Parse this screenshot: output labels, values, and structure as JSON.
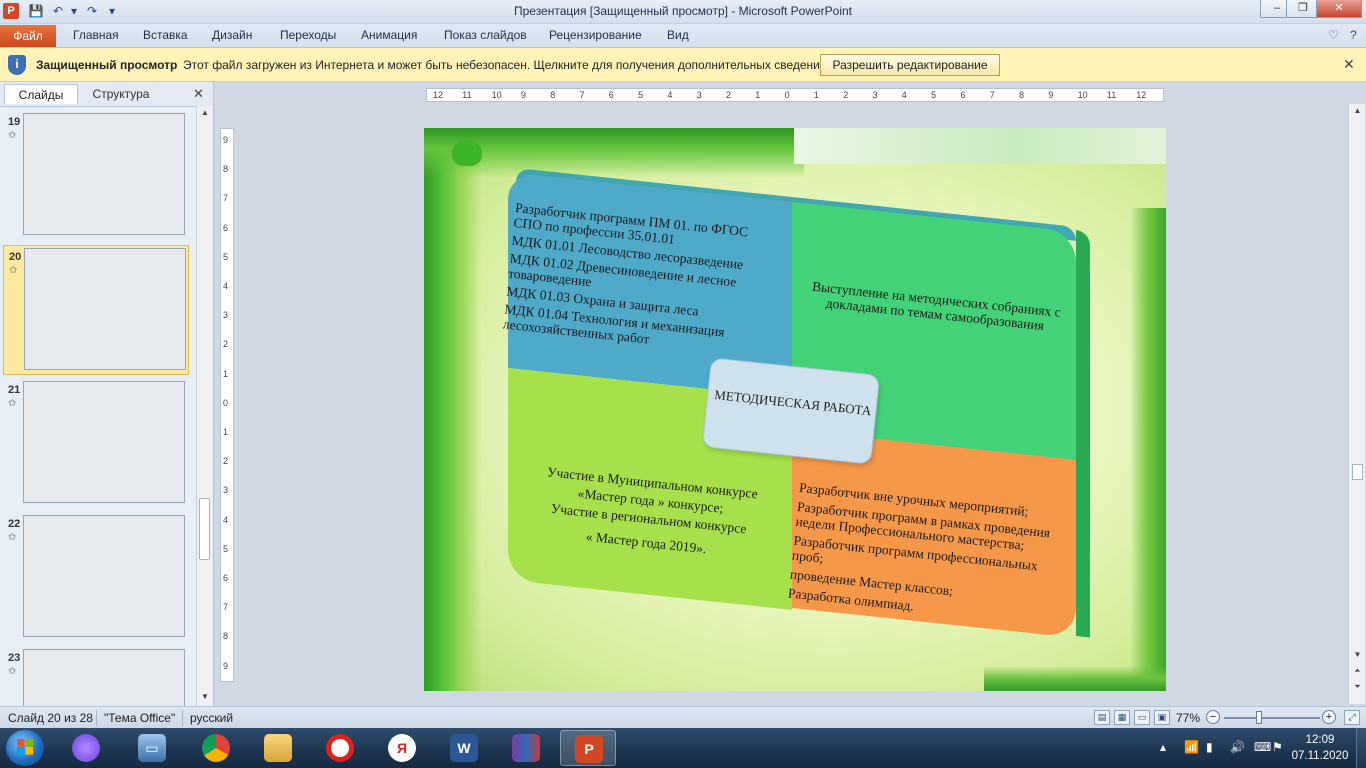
{
  "window": {
    "title": "Презентация [Защищенный просмотр]  -  Microsoft PowerPoint",
    "app_icon": "P"
  },
  "ribbon": {
    "file_tab": "Файл",
    "tabs": [
      "Главная",
      "Вставка",
      "Дизайн",
      "Переходы",
      "Анимация",
      "Показ слайдов",
      "Рецензирование",
      "Вид"
    ]
  },
  "protected_view": {
    "title": "Защищенный просмотр",
    "message": "Этот файл загружен из Интернета и может быть небезопасен. Щелкните для получения дополнительных сведений.",
    "enable_button": "Разрешить редактирование"
  },
  "left_panel": {
    "tab_slides": "Слайды",
    "tab_outline": "Структура",
    "thumbnails": [
      {
        "number": "19",
        "selected": false
      },
      {
        "number": "20",
        "selected": true
      },
      {
        "number": "21",
        "selected": false
      },
      {
        "number": "22",
        "selected": false
      },
      {
        "number": "23",
        "selected": false
      }
    ]
  },
  "ruler": {
    "horizontal": [
      "12",
      "11",
      "10",
      "9",
      "8",
      "7",
      "6",
      "5",
      "4",
      "3",
      "2",
      "1",
      "0",
      "1",
      "2",
      "3",
      "4",
      "5",
      "6",
      "7",
      "8",
      "9",
      "10",
      "11",
      "12"
    ],
    "vertical": [
      "9",
      "8",
      "7",
      "6",
      "5",
      "4",
      "3",
      "2",
      "1",
      "0",
      "1",
      "2",
      "3",
      "4",
      "5",
      "6",
      "7",
      "8",
      "9"
    ]
  },
  "slide": {
    "center": "МЕТОДИЧЕСКАЯ РАБОТА",
    "top_left": [
      "Разработчик программ ПМ 01. по ФГОС СПО по профессии  35.01.01",
      "МДК 01.01 Лесоводство лесоразведение",
      "МДК 01.02 Древесиноведение и лесное товароведение",
      "МДК 01.03 Охрана и защита леса",
      "МДК 01.04 Технология  и механизация лесохозяйственных  работ"
    ],
    "top_right": "Выступление на методических собраниях с докладами по темам самообразования",
    "bottom_left": [
      "Участие в Муниципальном конкурсе",
      "«Мастер  года » конкурсе;",
      "Участие в региональном конкурсе",
      "« Мастер года 2019»."
    ],
    "bottom_right": [
      "Разработчик вне урочных мероприятий;",
      "Разработчик программ в рамках проведения недели Профессионального мастерства;",
      "Разработчик  программ  профессиональных проб;",
      "проведение Мастер классов;",
      "Разработка  олимпиад."
    ]
  },
  "status": {
    "slide_counter": "Слайд 20 из 28",
    "theme": "\"Тема Office\"",
    "language": "русский",
    "zoom": "77%",
    "zoom_level_percent": 77
  },
  "taskbar": {
    "clock_time": "12:09",
    "clock_date": "07.11.2020"
  },
  "colors": {
    "file_tab": "#d24726",
    "protected_bar": "#fff3b8",
    "quad_blue": "#4fa9c8",
    "quad_green": "#43d277",
    "quad_lime": "#a6e04a",
    "quad_orange": "#f6984a"
  }
}
